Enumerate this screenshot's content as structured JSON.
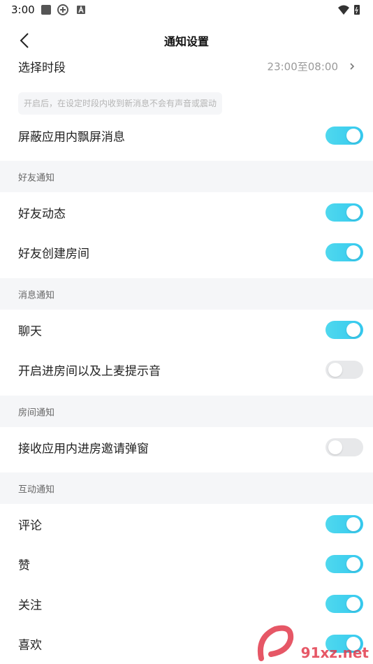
{
  "status": {
    "time": "3:00"
  },
  "header": {
    "title": "通知设置"
  },
  "time_range": {
    "label": "选择时段",
    "value": "23:00至08:00"
  },
  "hint": "开启后，在设定时段内收到新消息不会有声音或震动",
  "rows": [
    {
      "label": "屏蔽应用内飘屏消息",
      "on": true
    },
    {
      "label": "好友动态",
      "on": true
    },
    {
      "label": "好友创建房间",
      "on": true
    },
    {
      "label": "聊天",
      "on": true
    },
    {
      "label": "开启进房间以及上麦提示音",
      "on": false
    },
    {
      "label": "接收应用内进房邀请弹窗",
      "on": false
    },
    {
      "label": "评论",
      "on": true
    },
    {
      "label": "赞",
      "on": true
    },
    {
      "label": "关注",
      "on": true
    },
    {
      "label": "喜欢",
      "on": true
    }
  ],
  "sections": {
    "friend": "好友通知",
    "message": "消息通知",
    "room": "房间通知",
    "interaction": "互动通知"
  },
  "watermark": "91xz.net",
  "colors": {
    "toggle_on": "#3fd0ee",
    "toggle_off": "#e7e8ea",
    "section_bg": "#f5f6f8"
  }
}
